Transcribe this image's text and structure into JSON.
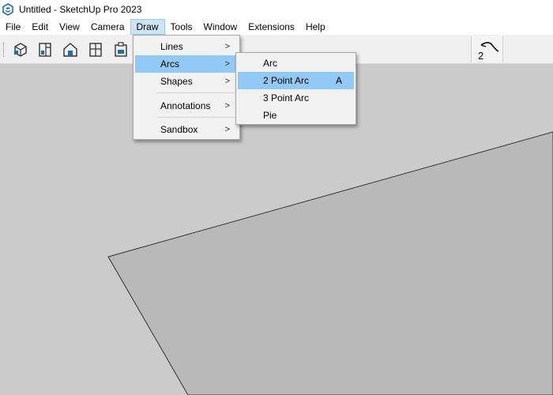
{
  "window": {
    "title": "Untitled - SketchUp Pro 2023"
  },
  "menubar": {
    "items": [
      "File",
      "Edit",
      "View",
      "Camera",
      "Draw",
      "Tools",
      "Window",
      "Extensions",
      "Help"
    ],
    "active": "Draw"
  },
  "toolbar": {
    "buttons": [
      "make-component-icon",
      "section-plane-icon",
      "warehouse-home-icon",
      "window-panels-icon",
      "clipboard-scene-icon"
    ],
    "right_tool": {
      "icon": "freehand-curve-icon",
      "label": "2"
    }
  },
  "draw_menu": {
    "items": [
      {
        "label": "Lines",
        "submenu": true
      },
      {
        "label": "Arcs",
        "submenu": true,
        "highlighted": true
      },
      {
        "label": "Shapes",
        "submenu": true
      },
      {
        "label": "Annotations",
        "submenu": true
      },
      {
        "label": "Sandbox",
        "submenu": true
      }
    ],
    "submenu_arrow": ">"
  },
  "arcs_menu": {
    "items": [
      {
        "label": "Arc",
        "shortcut": ""
      },
      {
        "label": "2 Point Arc",
        "shortcut": "A",
        "highlighted": true
      },
      {
        "label": "3 Point Arc",
        "shortcut": ""
      },
      {
        "label": "Pie",
        "shortcut": ""
      }
    ]
  },
  "colors": {
    "viewport_bg": "#cbcbcb",
    "face": "#b9b9b9",
    "highlight": "#91c9f7",
    "menu_active": "#cce4f7",
    "app_icon": "#1e6fa8"
  }
}
